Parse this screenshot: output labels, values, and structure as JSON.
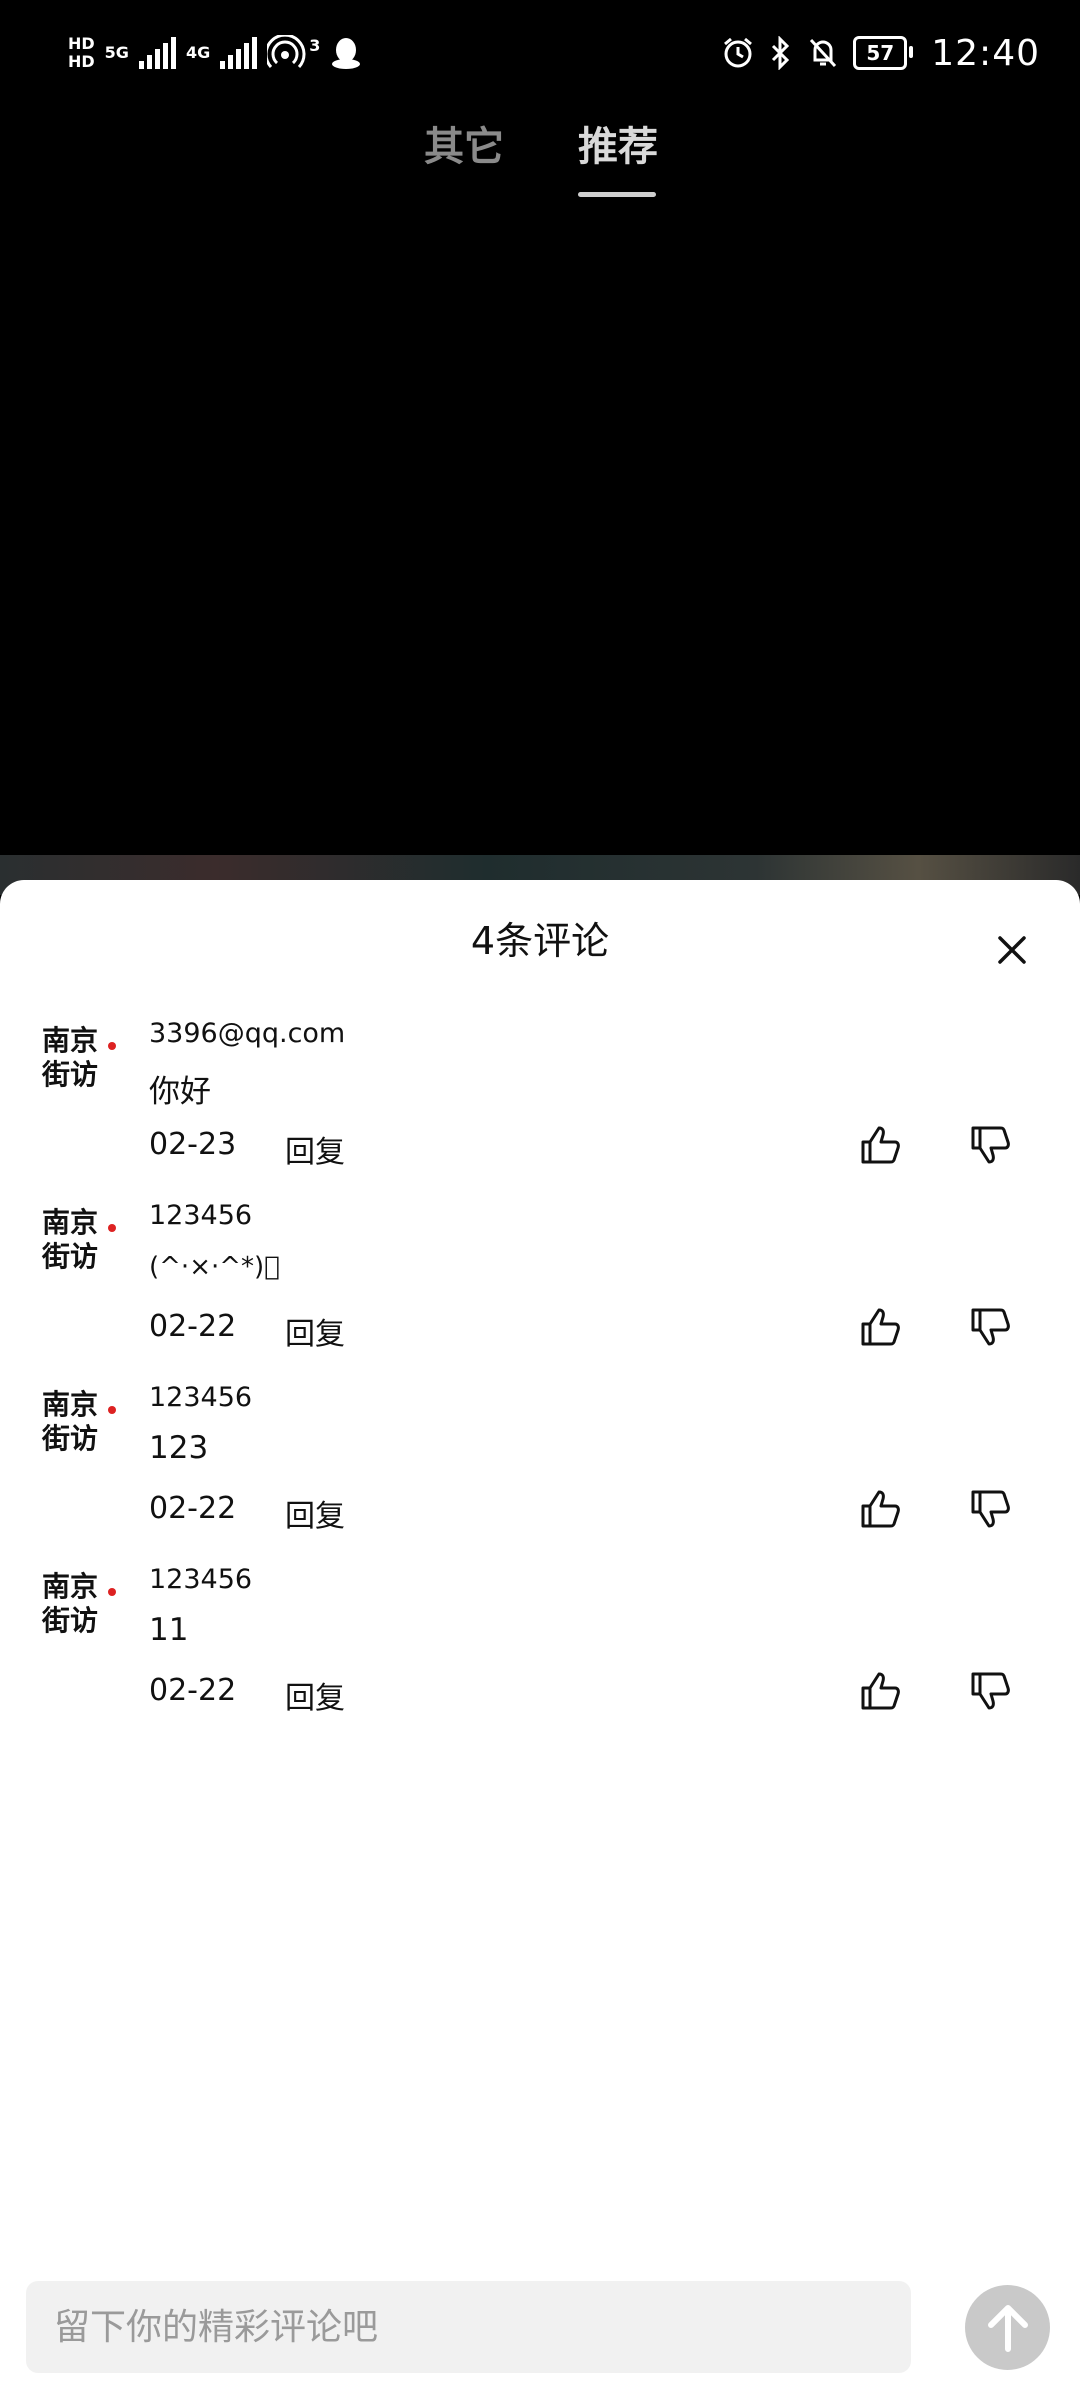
{
  "status_bar": {
    "hd_top": "HD",
    "hd_bottom": "HD",
    "net1": "5G",
    "net2": "4G",
    "hotspot_count": "3",
    "battery": "57",
    "time": "12:40"
  },
  "tabs": [
    {
      "label": "其它",
      "active": false
    },
    {
      "label": "推荐",
      "active": true
    }
  ],
  "sheet": {
    "title": "4条评论",
    "reply_label": "回复"
  },
  "comments": [
    {
      "username": "3396@qq.com",
      "content": "你好",
      "date": "02-23"
    },
    {
      "username": "123456",
      "content": "(^·×·^*)ﾞ",
      "date": "02-22"
    },
    {
      "username": "123456",
      "content": "123",
      "date": "02-22"
    },
    {
      "username": "123456",
      "content": "11",
      "date": "02-22"
    }
  ],
  "input": {
    "placeholder": "留下你的精彩评论吧"
  },
  "colors": {
    "background_top": "#000000",
    "sheet": "#ffffff",
    "input_bg": "#f1f1f1",
    "send_button": "#c9c9c9"
  }
}
